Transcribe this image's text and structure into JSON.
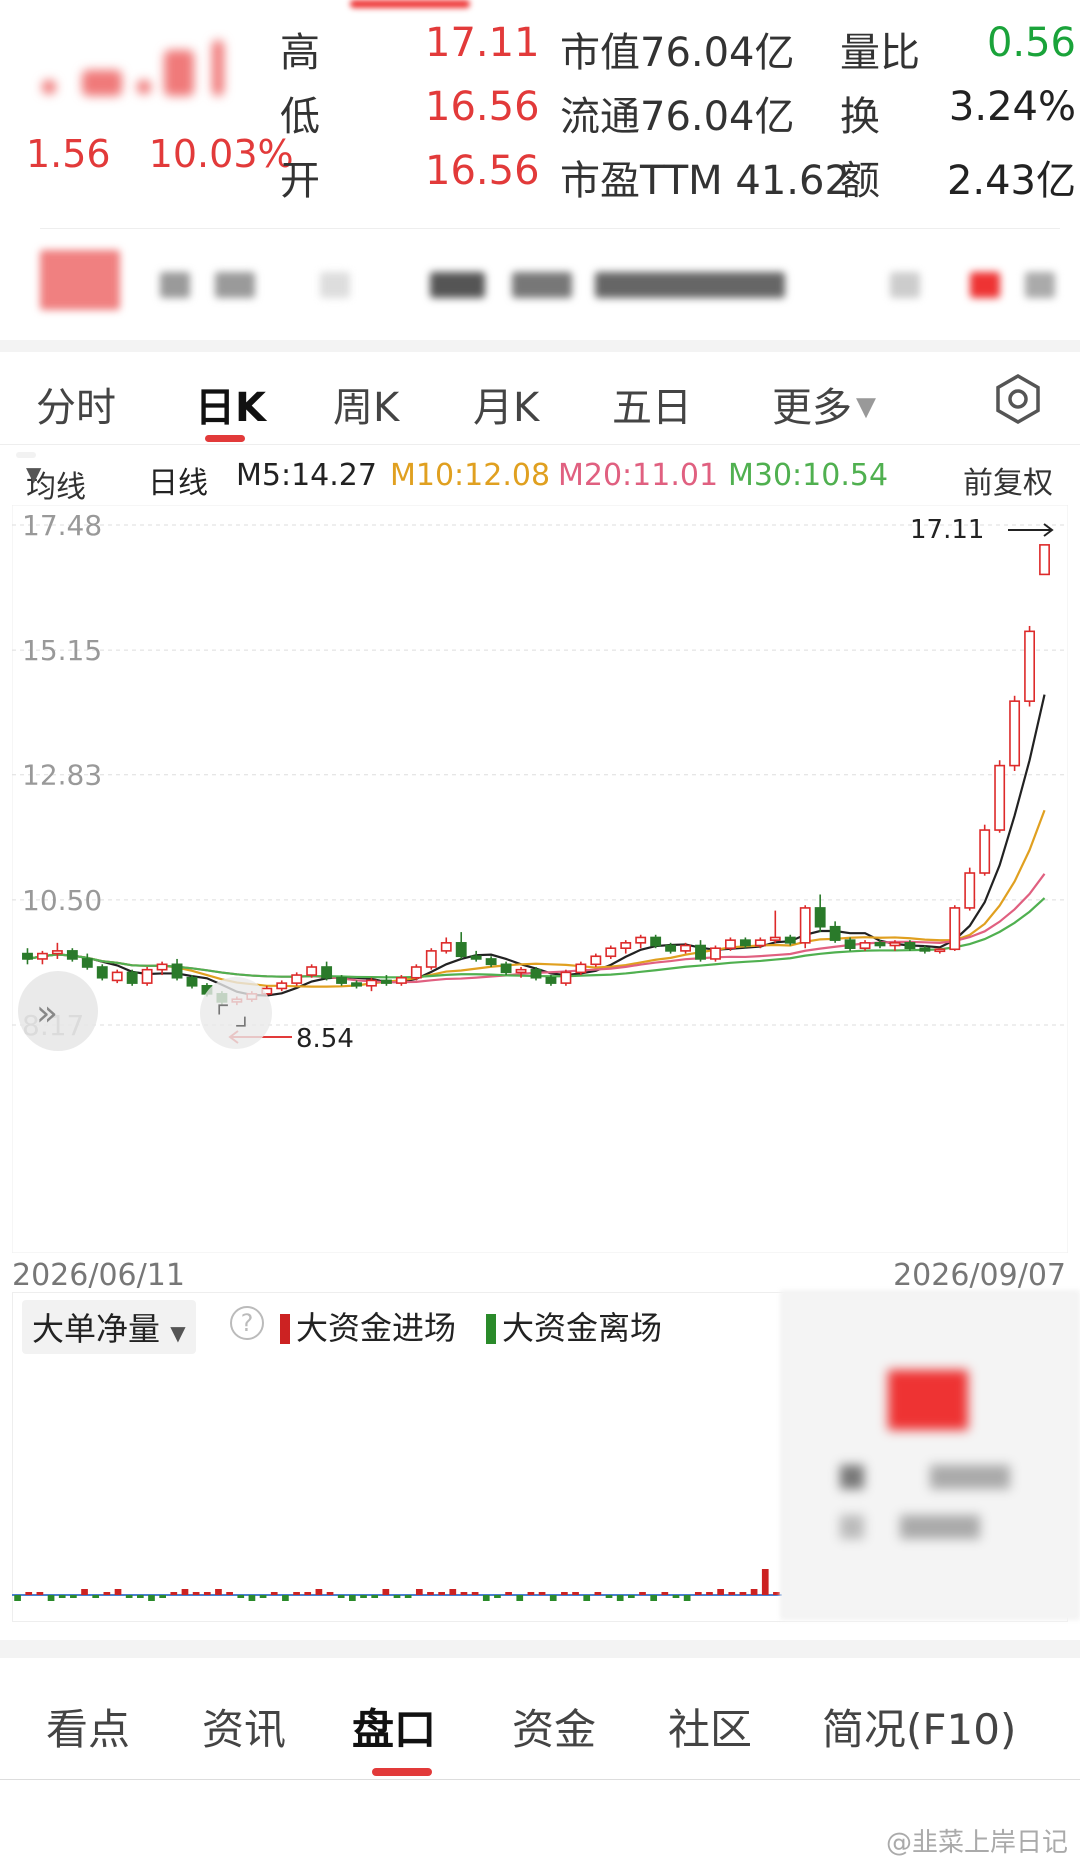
{
  "quote": {
    "change": "1.56",
    "change_pct": "10.03%",
    "rows": [
      {
        "label": "高",
        "value": "17.11",
        "metric": "市值76.04亿",
        "label2": "量比",
        "value2": "0.56"
      },
      {
        "label": "低",
        "value": "16.56",
        "metric": "流通76.04亿",
        "label2": "换",
        "value2": "3.24%"
      },
      {
        "label": "开",
        "value": "16.56",
        "metric": "市盈TTM 41.62",
        "label2": "额",
        "value2": "2.43亿"
      }
    ]
  },
  "period_tabs": [
    "分时",
    "日K",
    "周K",
    "月K",
    "五日",
    "更多"
  ],
  "active_period": "日K",
  "ma_bar": {
    "select": "均线",
    "line_type": "日线",
    "m5": "M5:14.27",
    "m10": "M10:12.08",
    "m20": "M20:11.01",
    "m30": "M30:10.54",
    "adjust": "前复权"
  },
  "chart_data": {
    "type": "candlestick",
    "y_ticks": [
      "17.48",
      "15.15",
      "12.83",
      "10.50",
      "8.17"
    ],
    "ylim": [
      8.17,
      17.48
    ],
    "x_start": "2026/06/11",
    "x_end": "2026/09/07",
    "max_label": "17.11",
    "min_label": "8.54",
    "ohlc": [
      [
        9.5,
        9.6,
        9.3,
        9.4
      ],
      [
        9.4,
        9.55,
        9.3,
        9.5
      ],
      [
        9.5,
        9.7,
        9.4,
        9.55
      ],
      [
        9.55,
        9.6,
        9.35,
        9.4
      ],
      [
        9.4,
        9.5,
        9.2,
        9.25
      ],
      [
        9.25,
        9.3,
        9.0,
        9.05
      ],
      [
        9.0,
        9.2,
        8.95,
        9.15
      ],
      [
        9.15,
        9.2,
        8.9,
        8.95
      ],
      [
        8.95,
        9.25,
        8.9,
        9.2
      ],
      [
        9.2,
        9.35,
        9.1,
        9.3
      ],
      [
        9.3,
        9.4,
        9.0,
        9.05
      ],
      [
        9.05,
        9.1,
        8.85,
        8.9
      ],
      [
        8.9,
        8.95,
        8.7,
        8.75
      ],
      [
        8.75,
        8.8,
        8.55,
        8.6
      ],
      [
        8.6,
        8.7,
        8.54,
        8.65
      ],
      [
        8.65,
        8.8,
        8.6,
        8.75
      ],
      [
        8.75,
        8.9,
        8.7,
        8.85
      ],
      [
        8.85,
        9.0,
        8.8,
        8.95
      ],
      [
        8.95,
        9.15,
        8.9,
        9.1
      ],
      [
        9.1,
        9.3,
        9.05,
        9.25
      ],
      [
        9.25,
        9.35,
        9.0,
        9.05
      ],
      [
        9.05,
        9.1,
        8.9,
        8.95
      ],
      [
        8.95,
        9.0,
        8.85,
        8.9
      ],
      [
        8.9,
        9.05,
        8.8,
        9.0
      ],
      [
        9.0,
        9.1,
        8.9,
        8.95
      ],
      [
        8.95,
        9.1,
        8.9,
        9.05
      ],
      [
        9.05,
        9.3,
        9.0,
        9.25
      ],
      [
        9.25,
        9.6,
        9.2,
        9.55
      ],
      [
        9.55,
        9.8,
        9.5,
        9.7
      ],
      [
        9.7,
        9.9,
        9.4,
        9.45
      ],
      [
        9.45,
        9.55,
        9.35,
        9.4
      ],
      [
        9.4,
        9.45,
        9.25,
        9.3
      ],
      [
        9.3,
        9.35,
        9.1,
        9.15
      ],
      [
        9.15,
        9.25,
        9.05,
        9.2
      ],
      [
        9.2,
        9.25,
        9.0,
        9.05
      ],
      [
        9.05,
        9.1,
        8.9,
        8.95
      ],
      [
        8.95,
        9.2,
        8.9,
        9.15
      ],
      [
        9.15,
        9.35,
        9.1,
        9.3
      ],
      [
        9.3,
        9.5,
        9.25,
        9.45
      ],
      [
        9.45,
        9.65,
        9.4,
        9.6
      ],
      [
        9.6,
        9.75,
        9.5,
        9.7
      ],
      [
        9.7,
        9.85,
        9.6,
        9.8
      ],
      [
        9.8,
        9.85,
        9.6,
        9.65
      ],
      [
        9.65,
        9.7,
        9.5,
        9.55
      ],
      [
        9.55,
        9.7,
        9.5,
        9.65
      ],
      [
        9.65,
        9.75,
        9.35,
        9.4
      ],
      [
        9.4,
        9.65,
        9.35,
        9.6
      ],
      [
        9.6,
        9.8,
        9.55,
        9.75
      ],
      [
        9.75,
        9.8,
        9.6,
        9.65
      ],
      [
        9.65,
        9.8,
        9.6,
        9.75
      ],
      [
        9.75,
        10.3,
        9.7,
        9.8
      ],
      [
        9.8,
        9.85,
        9.65,
        9.7
      ],
      [
        9.7,
        10.4,
        9.6,
        10.35
      ],
      [
        10.35,
        10.6,
        9.9,
        10.0
      ],
      [
        10.0,
        10.1,
        9.7,
        9.75
      ],
      [
        9.75,
        9.8,
        9.55,
        9.6
      ],
      [
        9.6,
        9.75,
        9.55,
        9.7
      ],
      [
        9.7,
        9.75,
        9.6,
        9.65
      ],
      [
        9.65,
        9.75,
        9.55,
        9.7
      ],
      [
        9.7,
        9.75,
        9.55,
        9.6
      ],
      [
        9.6,
        9.65,
        9.5,
        9.55
      ],
      [
        9.55,
        9.6,
        9.5,
        9.58
      ],
      [
        9.58,
        10.4,
        9.55,
        10.35
      ],
      [
        10.35,
        11.1,
        10.3,
        11.0
      ],
      [
        11.0,
        11.9,
        10.95,
        11.8
      ],
      [
        11.8,
        13.1,
        11.75,
        13.0
      ],
      [
        13.0,
        14.3,
        12.9,
        14.2
      ],
      [
        14.2,
        15.6,
        14.1,
        15.5
      ],
      [
        16.56,
        17.11,
        16.56,
        17.11
      ]
    ],
    "series": [
      {
        "name": "M5",
        "color": "#222222"
      },
      {
        "name": "M10",
        "color": "#e0a020"
      },
      {
        "name": "M20",
        "color": "#e06080"
      },
      {
        "name": "M30",
        "color": "#50b050"
      }
    ]
  },
  "fund_flow": {
    "title": "大单净量",
    "help": "?",
    "legend_in": "大资金进场",
    "legend_out": "大资金离场",
    "colors": {
      "in": "#cc2222",
      "out": "#2a8a2a"
    }
  },
  "bottom_tabs": [
    "看点",
    "资讯",
    "盘口",
    "资金",
    "社区",
    "简况(F10)"
  ],
  "active_bottom": "盘口",
  "watermark": "@韭菜上岸日记"
}
